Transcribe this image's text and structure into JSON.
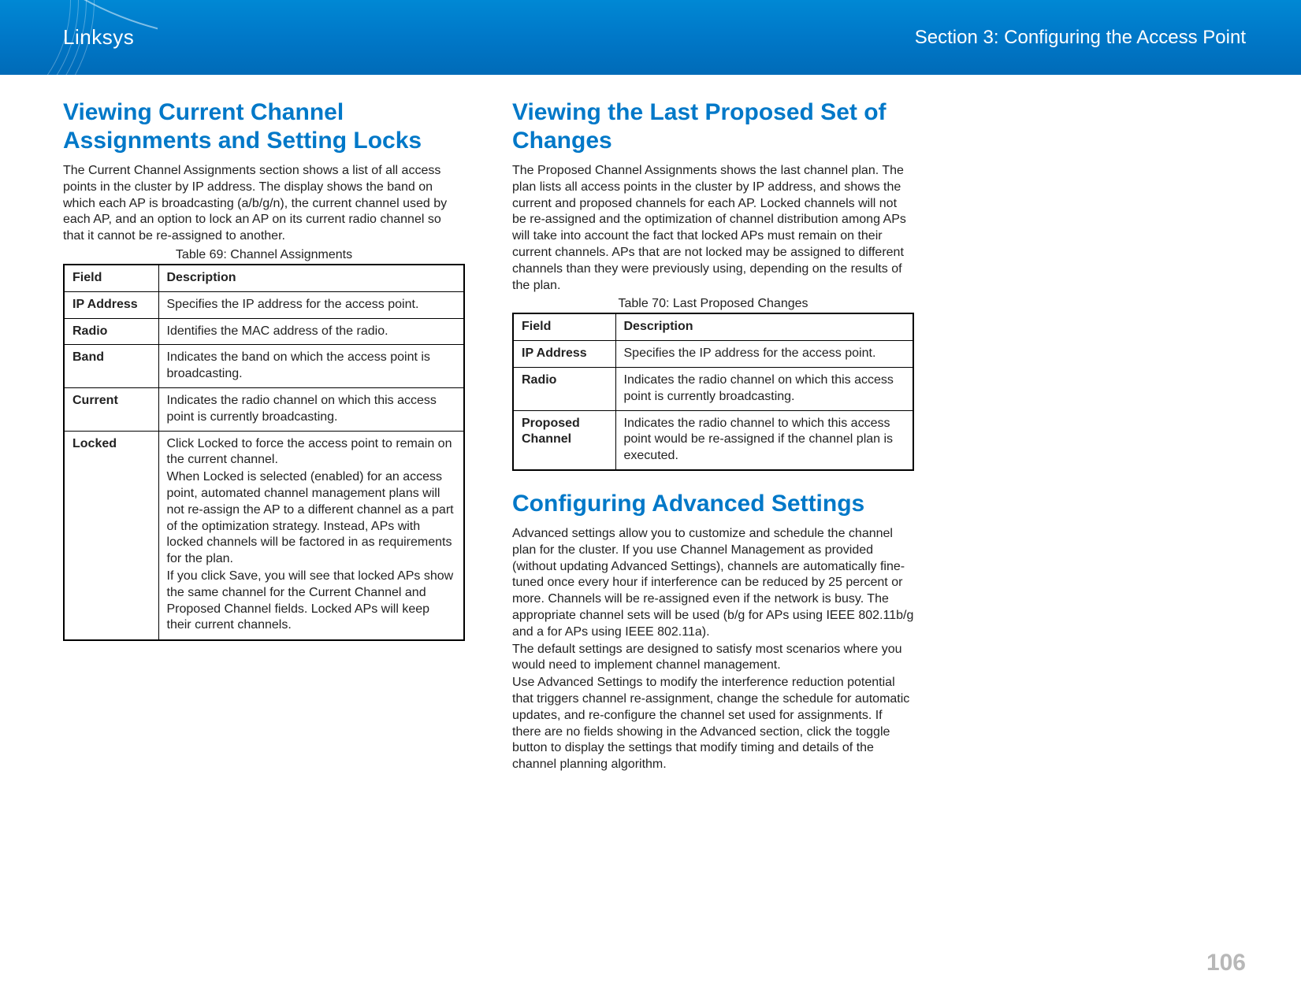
{
  "header": {
    "brand": "Linksys",
    "section": "Section 3:  Configuring the Access Point"
  },
  "page_number": "106",
  "left_column": {
    "heading": "Viewing Current Channel Assignments and Setting Locks",
    "intro": "The Current Channel Assignments section shows a list of all access points in the cluster by IP address. The display shows the band on which each AP is broadcasting (a/b/g/n), the current channel used by each AP, and an option to lock an AP on its current radio channel so that it cannot be re-assigned to another.",
    "table_caption": "Table 69: Channel Assignments",
    "table": {
      "header": {
        "field": "Field",
        "desc": "Description"
      },
      "rows": [
        {
          "field": "IP Address",
          "desc": "Specifies the IP address for the access point."
        },
        {
          "field": "Radio",
          "desc": "Identifies the MAC address of the radio."
        },
        {
          "field": "Band",
          "desc": "Indicates the band on which the access point is broadcasting."
        },
        {
          "field": "Current",
          "desc": "Indicates the radio channel on which this access point is currently broadcasting."
        },
        {
          "field": "Locked",
          "desc_p1": "Click Locked to force the access point to remain on the current channel.",
          "desc_p2": "When Locked is selected (enabled) for an access point, automated channel management plans will not re-assign the AP to a different channel as a part of the optimization strategy. Instead, APs with locked channels will be factored in as requirements for the plan.",
          "desc_p3": "If you click Save, you will see that locked APs show the same channel for the Current Channel and Proposed Channel fields. Locked APs will keep their current channels."
        }
      ]
    }
  },
  "right_column": {
    "section1": {
      "heading": "Viewing the Last Proposed Set of Changes",
      "intro": "The Proposed Channel Assignments shows the last channel plan. The plan lists all access points in the cluster by IP address, and shows the current and proposed channels for each AP. Locked channels will not be re-assigned and the optimization of channel distribution among APs will take into account the fact that locked APs must remain on their current channels. APs that are not locked may be assigned to different channels than they were previously using, depending on the results of the plan.",
      "table_caption": "Table 70: Last Proposed Changes",
      "table": {
        "header": {
          "field": "Field",
          "desc": "Description"
        },
        "rows": [
          {
            "field": "IP Address",
            "desc": "Specifies the IP address for the access point."
          },
          {
            "field": "Radio",
            "desc": "Indicates the radio channel on which this access point is currently broadcasting."
          },
          {
            "field": "Proposed Channel",
            "desc": "Indicates the radio channel to which this access point would be re-assigned if the channel plan is executed."
          }
        ]
      }
    },
    "section2": {
      "heading": "Configuring Advanced Settings",
      "p1": "Advanced settings allow you to customize and schedule the channel plan for the cluster. If you use Channel Management as provided (without updating Advanced Settings), channels are automatically fine-tuned once every hour if interference can be reduced by 25 percent or more. Channels will be re-assigned even if the network is busy. The appropriate channel sets will be used (b/g for APs using IEEE 802.11b/g and a for APs using IEEE 802.11a).",
      "p2": "The default settings are designed to satisfy most scenarios where you would need to implement channel management.",
      "p3": "Use Advanced Settings to modify the interference reduction potential that triggers channel re-assignment, change the schedule for automatic updates, and re-configure the channel set used for assignments. If there are no fields showing in the Advanced section, click the toggle button to display the settings that modify timing and details of the channel planning algorithm."
    }
  }
}
